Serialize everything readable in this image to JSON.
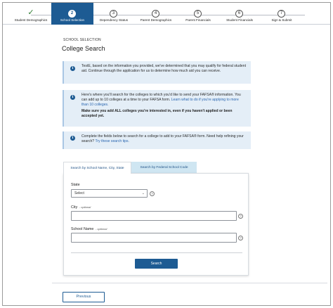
{
  "stepper": {
    "steps": [
      {
        "num": "✓",
        "label": "Student Demographics",
        "state": "complete"
      },
      {
        "num": "2",
        "label": "School Selection",
        "state": "active"
      },
      {
        "num": "3",
        "label": "Dependency Status",
        "state": "upcoming"
      },
      {
        "num": "4",
        "label": "Parent Demographics",
        "state": "upcoming"
      },
      {
        "num": "5",
        "label": "Parent Financials",
        "state": "upcoming"
      },
      {
        "num": "6",
        "label": "Student Financials",
        "state": "upcoming"
      },
      {
        "num": "7",
        "label": "Sign & Submit",
        "state": "upcoming"
      }
    ]
  },
  "header": {
    "section_label": "SCHOOL SELECTION",
    "title": "College Search"
  },
  "info": {
    "icon_glyph": "i",
    "box1": {
      "text": "TestE, based on the information you provided, we've determined that you may qualify for federal student aid. Continue through the application for us to determine how much aid you can receive."
    },
    "box2": {
      "text": "Here's where you'll search for the colleges to which you'd like to send your FAFSA® information. You can add up to 10 colleges at a time to your FAFSA form.",
      "link": "Learn what to do if you're applying to more than 10 colleges.",
      "bold": "Make sure you add ALL colleges you're interested in, even if you haven't applied or been accepted yet."
    },
    "box3": {
      "text": "Complete the fields below to search for a college to add to your FAFSA® form. Need help refining your search?",
      "link": "Try these search tips."
    }
  },
  "tabs": {
    "name_city_state": "Search by School Name, City, State",
    "federal_code": "Search by Federal School Code"
  },
  "form": {
    "state_label": "State",
    "state_value": "Select",
    "city_label": "City",
    "city_optional": "- optional",
    "school_label": "School Name",
    "school_optional": "- optional",
    "help_glyph": "?",
    "search_button": "Search"
  },
  "footer": {
    "previous_button": "Previous"
  },
  "colors": {
    "primary": "#1d5b93",
    "info_bg": "#e4eef7",
    "tab_inactive_bg": "#cfe6f2",
    "complete_check": "#2e7d32"
  },
  "icons": {
    "info": "info-icon",
    "help": "help-icon",
    "select": "chevron-down-icon",
    "complete": "check-icon"
  }
}
